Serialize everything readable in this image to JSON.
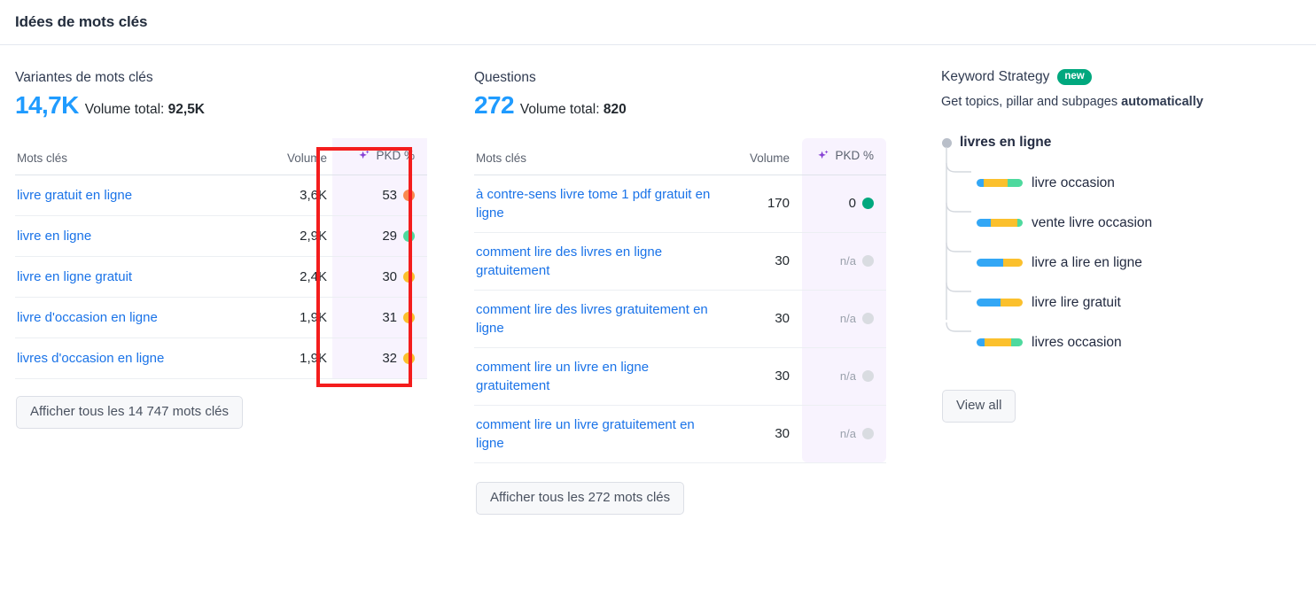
{
  "header": {
    "title": "Idées de mots clés"
  },
  "variants": {
    "title": "Variantes de mots clés",
    "count": "14,7K",
    "volume_label": "Volume total:",
    "volume_value": "92,5K",
    "columns": {
      "keyword": "Mots clés",
      "volume": "Volume",
      "pkd": "PKD %"
    },
    "pkd_icon": "sparkle-icon",
    "rows": [
      {
        "keyword": "livre gratuit en ligne",
        "volume": "3,6K",
        "pkd": "53",
        "pkd_color": "#f9884f"
      },
      {
        "keyword": "livre en ligne",
        "volume": "2,9K",
        "pkd": "29",
        "pkd_color": "#4ed99e"
      },
      {
        "keyword": "livre en ligne gratuit",
        "volume": "2,4K",
        "pkd": "30",
        "pkd_color": "#fbc02d"
      },
      {
        "keyword": "livre d'occasion en ligne",
        "volume": "1,9K",
        "pkd": "31",
        "pkd_color": "#fbc02d"
      },
      {
        "keyword": "livres d'occasion en ligne",
        "volume": "1,9K",
        "pkd": "32",
        "pkd_color": "#fbc02d"
      }
    ],
    "show_all_button": "Afficher tous les 14 747 mots clés"
  },
  "questions": {
    "title": "Questions",
    "count": "272",
    "volume_label": "Volume total:",
    "volume_value": "820",
    "columns": {
      "keyword": "Mots clés",
      "volume": "Volume",
      "pkd": "PKD %"
    },
    "pkd_icon": "sparkle-icon",
    "rows": [
      {
        "keyword": "à contre-sens livre tome 1 pdf gratuit en ligne",
        "volume": "170",
        "pkd": "0",
        "pkd_color": "#00a87e",
        "na": false
      },
      {
        "keyword": "comment lire des livres en ligne gratuitement",
        "volume": "30",
        "pkd": "n/a",
        "pkd_color": "#d9dce1",
        "na": true
      },
      {
        "keyword": "comment lire des livres gratuitement en ligne",
        "volume": "30",
        "pkd": "n/a",
        "pkd_color": "#d9dce1",
        "na": true
      },
      {
        "keyword": "comment lire un livre en ligne gratuitement",
        "volume": "30",
        "pkd": "n/a",
        "pkd_color": "#d9dce1",
        "na": true
      },
      {
        "keyword": "comment lire un livre gratuitement en ligne",
        "volume": "30",
        "pkd": "n/a",
        "pkd_color": "#d9dce1",
        "na": true
      }
    ],
    "show_all_button": "Afficher tous les 272 mots clés"
  },
  "strategy": {
    "title": "Keyword Strategy",
    "badge": "new",
    "subtitle_plain": "Get topics, pillar and subpages ",
    "subtitle_bold": "automatically",
    "root": "livres en ligne",
    "items": [
      {
        "label": "livre occasion",
        "segments": [
          {
            "color": "#33a7f5",
            "pct": 16
          },
          {
            "color": "#fbc02d",
            "pct": 52
          },
          {
            "color": "#4ed99e",
            "pct": 32
          }
        ]
      },
      {
        "label": "vente livre occasion",
        "segments": [
          {
            "color": "#33a7f5",
            "pct": 30
          },
          {
            "color": "#fbc02d",
            "pct": 58
          },
          {
            "color": "#4ed99e",
            "pct": 12
          }
        ]
      },
      {
        "label": "livre a lire en ligne",
        "segments": [
          {
            "color": "#33a7f5",
            "pct": 58
          },
          {
            "color": "#fbc02d",
            "pct": 42
          }
        ]
      },
      {
        "label": "livre lire gratuit",
        "segments": [
          {
            "color": "#33a7f5",
            "pct": 52
          },
          {
            "color": "#fbc02d",
            "pct": 48
          }
        ]
      },
      {
        "label": "livres occasion",
        "segments": [
          {
            "color": "#33a7f5",
            "pct": 18
          },
          {
            "color": "#fbc02d",
            "pct": 57
          },
          {
            "color": "#4ed99e",
            "pct": 25
          }
        ]
      }
    ],
    "view_all_button": "View all"
  },
  "annotation": {
    "highlight_color": "#f41d1d"
  }
}
